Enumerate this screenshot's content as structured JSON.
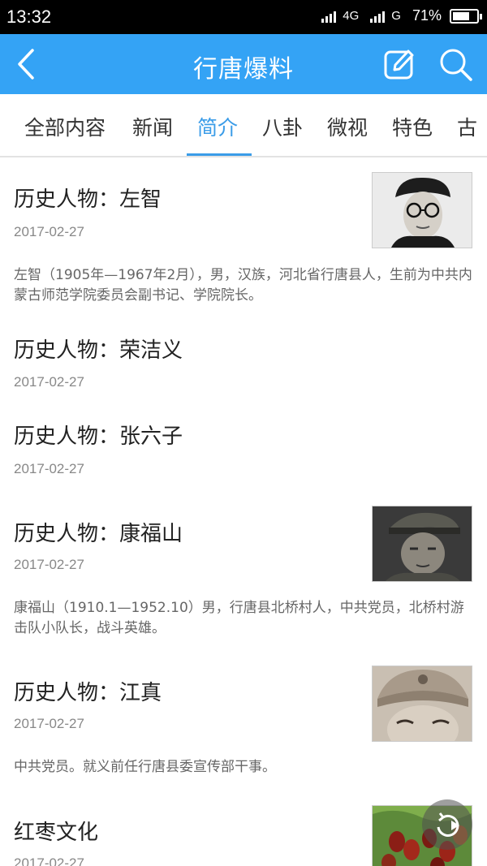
{
  "status_bar": {
    "time": "13:32",
    "network1": "4G",
    "network2": "G",
    "battery": "71%",
    "battery_level": 0.71
  },
  "header": {
    "title": "行唐爆料",
    "background": "#34a3f5"
  },
  "tabs": [
    "全部内容",
    "新闻",
    "简介",
    "八卦",
    "微视",
    "特色",
    "古"
  ],
  "active_tab_index": 2,
  "articles": [
    {
      "title": "历史人物：左智",
      "date": "2017-02-27",
      "summary": "左智（1905年—1967年2月），男，汉族，河北省行唐县人，生前为中共内蒙古师范学院委员会副书记、学院院长。",
      "thumbnail": "portrait-glasses"
    },
    {
      "title": "历史人物：荣洁义",
      "date": "2017-02-27"
    },
    {
      "title": "历史人物：张六子",
      "date": "2017-02-27"
    },
    {
      "title": "历史人物：康福山",
      "date": "2017-02-27",
      "summary": "康福山（1910.1—1952.10）男，行唐县北桥村人，中共党员，北桥村游击队小队长，战斗英雄。",
      "thumbnail": "portrait-cap"
    },
    {
      "title": "历史人物：江真",
      "date": "2017-02-27",
      "summary": "中共党员。就义前任行唐县委宣传部干事。",
      "thumbnail": "portrait-woman-cap"
    },
    {
      "title": "红枣文化",
      "date": "2017-02-27",
      "thumbnail": "jujube-photo"
    }
  ],
  "icons": {
    "back": "chevron-left-icon",
    "edit": "edit-icon",
    "search": "search-icon",
    "floating": "refresh-icon"
  }
}
